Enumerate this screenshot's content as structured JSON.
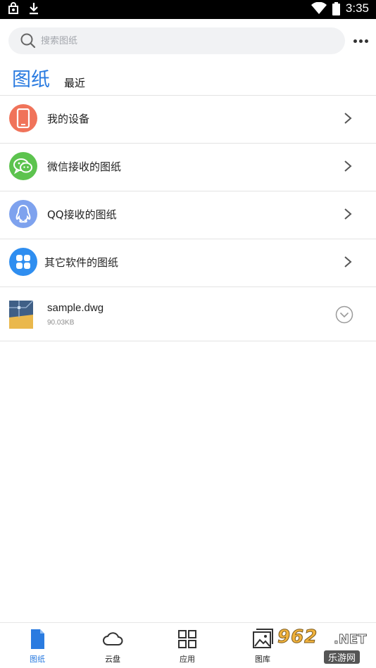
{
  "status_bar": {
    "time": "3:35"
  },
  "search": {
    "placeholder": "搜索图纸"
  },
  "tabs": {
    "active": "图纸",
    "recent": "最近"
  },
  "categories": [
    {
      "label": "我的设备",
      "icon": "phone-icon",
      "color": "#f0735a"
    },
    {
      "label": "微信接收的图纸",
      "icon": "wechat-icon",
      "color": "#5cc34e"
    },
    {
      "label": "QQ接收的图纸",
      "icon": "qq-icon",
      "color": "#7ea2ee"
    },
    {
      "label": "其它软件的图纸",
      "icon": "apps-grid-icon",
      "color": "#2f8ef0"
    }
  ],
  "files": [
    {
      "name": "sample.dwg",
      "size": "90.03KB"
    }
  ],
  "bottom_nav": [
    {
      "label": "图纸",
      "icon": "drawing-file-icon",
      "active": true
    },
    {
      "label": "云盘",
      "icon": "cloud-icon",
      "active": false
    },
    {
      "label": "应用",
      "icon": "apps-icon",
      "active": false
    },
    {
      "label": "图库",
      "icon": "gallery-icon",
      "active": false
    }
  ],
  "watermark": {
    "main": "962",
    "net": ".NET",
    "sub": "乐游网"
  },
  "colors": {
    "accent": "#2a7be0",
    "divider": "#e3e3e3"
  }
}
